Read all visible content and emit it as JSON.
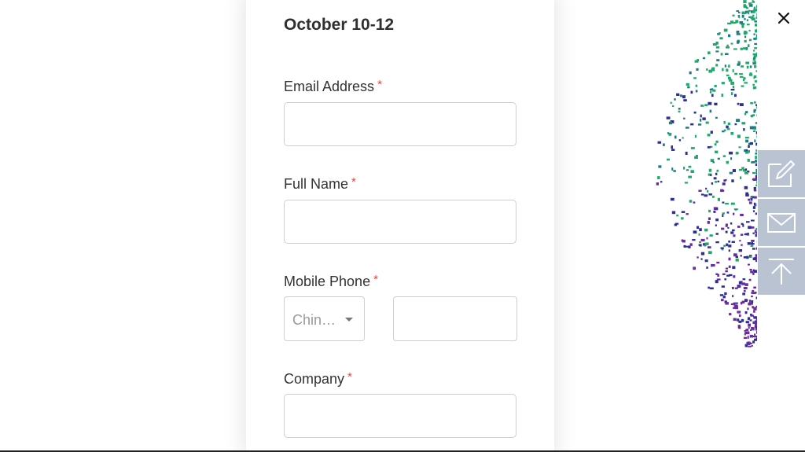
{
  "form": {
    "date_heading": "October 10-12",
    "required_mark": "*",
    "fields": {
      "email": {
        "label": "Email Address",
        "value": ""
      },
      "full_name": {
        "label": "Full Name",
        "value": ""
      },
      "mobile_phone": {
        "label": "Mobile Phone",
        "country_selected": "Chin…",
        "value": ""
      },
      "company": {
        "label": "Company",
        "value": ""
      }
    }
  },
  "window": {
    "close_icon": "close-icon"
  },
  "side_toolbar": {
    "items": [
      {
        "icon": "edit-icon"
      },
      {
        "icon": "mail-icon"
      },
      {
        "icon": "back-to-top-icon"
      }
    ],
    "color": "#b9c3d2"
  },
  "colors": {
    "required": "#e04646",
    "dot_green": "#1fa96a",
    "dot_teal": "#1f7a86",
    "dot_blue": "#2e2f92",
    "dot_purple": "#6a2aa0"
  }
}
